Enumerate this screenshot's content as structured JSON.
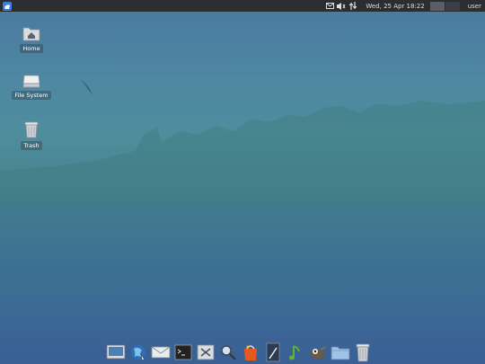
{
  "top_panel": {
    "clock": "Wed, 25 Apr  18:22",
    "user": "user",
    "icons": [
      "app-menu-icon",
      "mail-icon",
      "volume-icon",
      "network-icon"
    ]
  },
  "desktop": {
    "icons": [
      {
        "label": "Home",
        "icon": "home-folder-icon"
      },
      {
        "label": "File System",
        "icon": "drive-icon"
      },
      {
        "label": "Trash",
        "icon": "trash-icon"
      }
    ]
  },
  "dock": {
    "items": [
      "show-desktop",
      "web-browser",
      "mail",
      "terminal",
      "settings",
      "search",
      "software-store",
      "text-editor",
      "music-player",
      "image-editor",
      "file-manager",
      "trash"
    ]
  },
  "colors": {
    "panel": "#2b2d31",
    "sky_top": "#4a78a0",
    "water_bottom": "#3a5f95"
  }
}
